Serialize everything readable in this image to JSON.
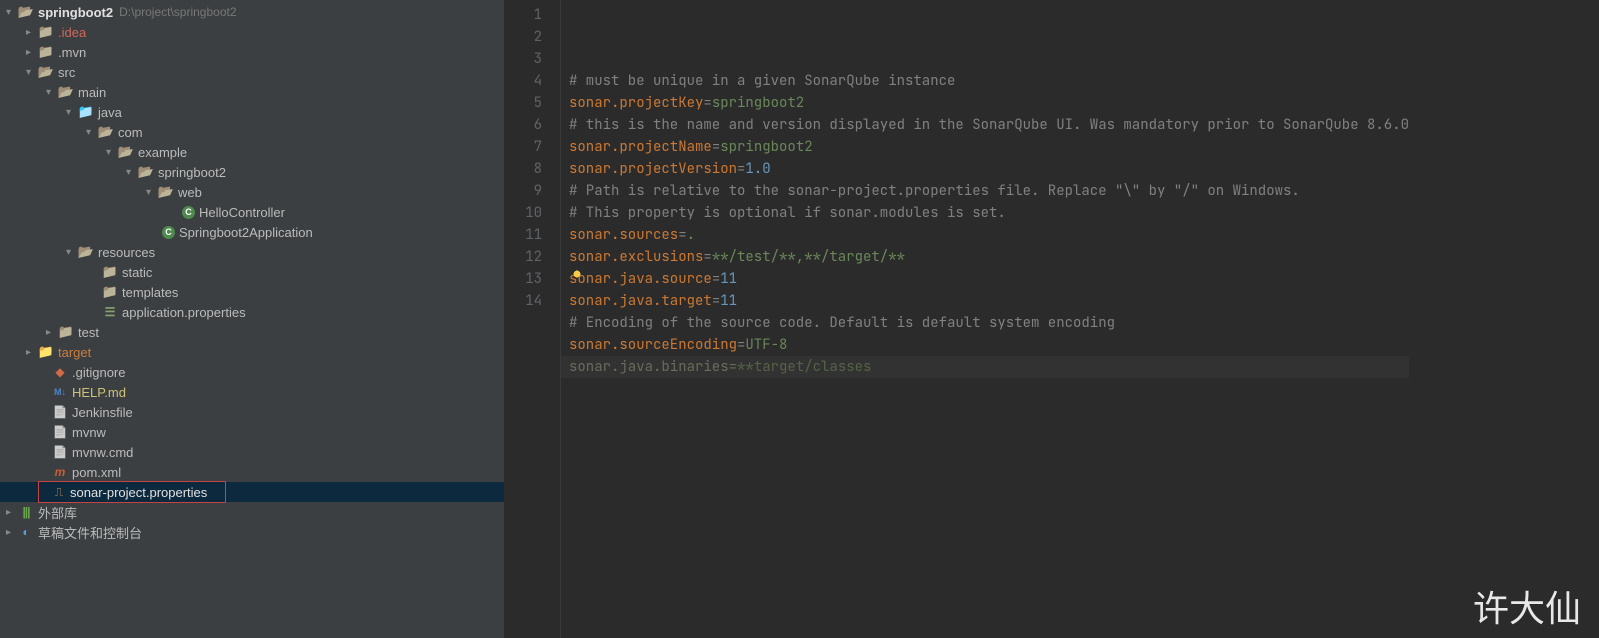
{
  "project": {
    "name": "springboot2",
    "path": "D:\\project\\springboot2"
  },
  "tree": {
    "idea": ".idea",
    "mvn": ".mvn",
    "src": "src",
    "main": "main",
    "java": "java",
    "com": "com",
    "example": "example",
    "springboot2": "springboot2",
    "web": "web",
    "helloController": "HelloController",
    "springboot2App": "Springboot2Application",
    "resources": "resources",
    "static": "static",
    "templates": "templates",
    "appProps": "application.properties",
    "test": "test",
    "target": "target",
    "gitignore": ".gitignore",
    "help": "HELP.md",
    "jenkinsfile": "Jenkinsfile",
    "mvnw": "mvnw",
    "mvnwcmd": "mvnw.cmd",
    "pom": "pom.xml",
    "sonarProps": "sonar-project.properties",
    "externalLibs": "外部库",
    "scratches": "草稿文件和控制台"
  },
  "editor": {
    "lines": [
      {
        "type": "comment",
        "text": "# must be unique in a given SonarQube instance"
      },
      {
        "type": "kv",
        "key": "sonar.projectKey",
        "val": "springboot2",
        "valKind": "str"
      },
      {
        "type": "comment",
        "text": "# this is the name and version displayed in the SonarQube UI. Was mandatory prior to SonarQube 8.6.0"
      },
      {
        "type": "kv",
        "key": "sonar.projectName",
        "val": "springboot2",
        "valKind": "str"
      },
      {
        "type": "kv",
        "key": "sonar.projectVersion",
        "val": "1.0",
        "valKind": "num"
      },
      {
        "type": "comment",
        "text": "# Path is relative to the sonar-project.properties file. Replace \"\\\" by \"/\" on Windows."
      },
      {
        "type": "comment",
        "text": "# This property is optional if sonar.modules is set."
      },
      {
        "type": "kv",
        "key": "sonar.sources",
        "val": ".",
        "valKind": "str"
      },
      {
        "type": "kv",
        "key": "sonar.exclusions",
        "val": "**/test/**,**/target/**",
        "valKind": "str"
      },
      {
        "type": "kv",
        "key": "sonar.java.source",
        "val": "11",
        "valKind": "num"
      },
      {
        "type": "kv",
        "key": "sonar.java.target",
        "val": "11",
        "valKind": "num"
      },
      {
        "type": "comment",
        "text": "# Encoding of the source code. Default is default system encoding"
      },
      {
        "type": "kv",
        "key": "sonar.sourceEncoding",
        "val": "UTF-8",
        "valKind": "str"
      },
      {
        "type": "kv-muted",
        "key": "sonar.java.binaries",
        "val": "**target/classes"
      }
    ]
  },
  "watermark": "许大仙"
}
